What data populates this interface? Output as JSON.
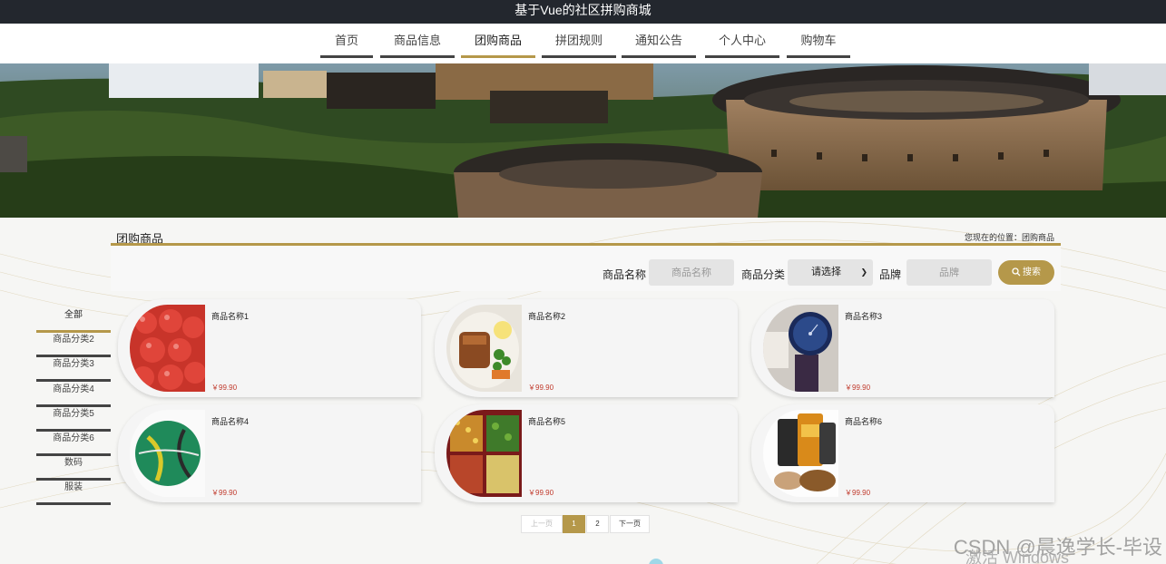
{
  "app_title": "基于Vue的社区拼购商城",
  "nav": [
    {
      "label": "首页"
    },
    {
      "label": "商品信息"
    },
    {
      "label": "团购商品",
      "active": true
    },
    {
      "label": "拼团规则"
    },
    {
      "label": "通知公告"
    },
    {
      "label": "个人中心"
    },
    {
      "label": "购物车"
    }
  ],
  "section": {
    "title": "团购商品",
    "breadcrumb": "您现在的位置：团购商品"
  },
  "search": {
    "name_label": "商品名称",
    "name_placeholder": "商品名称",
    "category_label": "商品分类",
    "category_value": "请选择",
    "brand_label": "品牌",
    "brand_placeholder": "品牌",
    "button_label": "搜索"
  },
  "categories": [
    {
      "label": "全部",
      "active": true
    },
    {
      "label": "商品分类2"
    },
    {
      "label": "商品分类3"
    },
    {
      "label": "商品分类4"
    },
    {
      "label": "商品分类5"
    },
    {
      "label": "商品分类6"
    },
    {
      "label": "数码"
    },
    {
      "label": "服装"
    }
  ],
  "products": [
    {
      "name": "商品名称1",
      "price": "￥99.90",
      "image": "cherries"
    },
    {
      "name": "商品名称2",
      "price": "￥99.90",
      "image": "food-plate"
    },
    {
      "name": "商品名称3",
      "price": "￥99.90",
      "image": "watch"
    },
    {
      "name": "商品名称4",
      "price": "￥99.90",
      "image": "football"
    },
    {
      "name": "商品名称5",
      "price": "￥99.90",
      "image": "bento-box"
    },
    {
      "name": "商品名称6",
      "price": "￥99.90",
      "image": "snack-bags"
    }
  ],
  "pagination": {
    "prev": "上一页",
    "pages": [
      "1",
      "2"
    ],
    "current": "1",
    "next": "下一页"
  },
  "watermark": "CSDN @晨逸学长-毕设",
  "os_watermark": "激活 Windows",
  "colors": {
    "accent": "#b5984a",
    "titlebar": "#23272e",
    "price": "#c0392b"
  }
}
